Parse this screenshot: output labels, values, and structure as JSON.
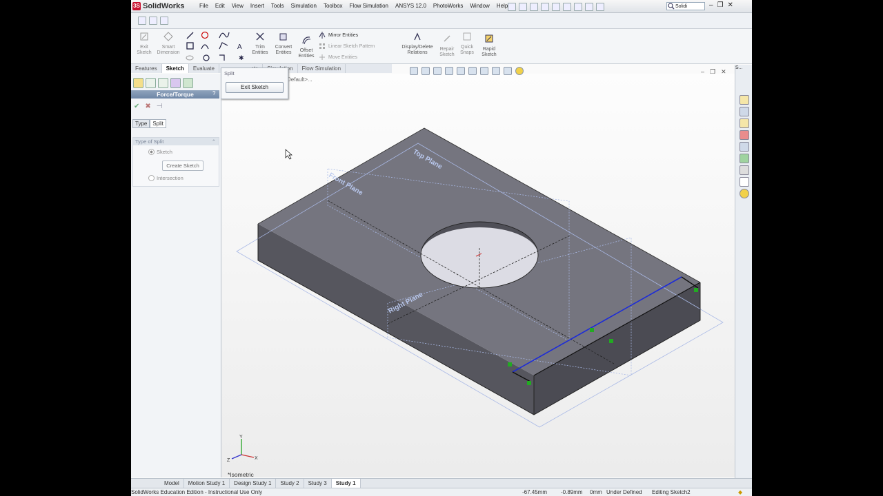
{
  "app": {
    "name": "SolidWorks"
  },
  "menu": [
    "File",
    "Edit",
    "View",
    "Insert",
    "Tools",
    "Simulation",
    "Toolbox",
    "Flow Simulation",
    "ANSYS 12.0",
    "PhotoWorks",
    "Window",
    "Help"
  ],
  "search": {
    "value": "Solidi"
  },
  "commands": {
    "exit_sketch": "Exit\nSketch",
    "smart_dimension": "Smart\nDimension",
    "mirror_entities": "Mirror Entities",
    "linear_sketch_pattern": "Linear Sketch Pattern",
    "move_entities": "Move Entities",
    "trim_entities": "Trim\nEntities",
    "convert_entities": "Convert\nEntities",
    "offset_entities": "Offset\nEntities",
    "display_delete_relations": "Display/Delete\nRelations",
    "repair_sketch": "Repair\nSketch",
    "quick_snaps": "Quick\nSnaps",
    "rapid_sketch": "Rapid\nSketch"
  },
  "tabs": [
    "Features",
    "Sketch",
    "Evaluate",
    "Office Products",
    "Simulation",
    "Flow Simulation"
  ],
  "tabs_visible": {
    "t0": "Features",
    "t1": "Sketch",
    "t2": "Evaluate",
    "t3": "cts",
    "t4": "Simulation",
    "t5": "Flow Simulation"
  },
  "left_panel": {
    "title": "Force/Torque",
    "tab_type": "Type",
    "tab_split": "Split",
    "group_title": "Type of Split",
    "opt_sketch": "Sketch",
    "create_sketch": "Create Sketch",
    "opt_intersection": "Intersection"
  },
  "popup": {
    "title": "Split",
    "exit_sketch": "Exit Sketch"
  },
  "viewport": {
    "breadcrumb": "Default>...",
    "top_plane": "Top Plane",
    "front_plane": "Front Plane",
    "right_plane": "Right Plane",
    "view_name": "*Isometric"
  },
  "bottom_tabs": [
    "Model",
    "Motion Study 1",
    "Design Study 1",
    "Study 2",
    "Study 3",
    "Study 1"
  ],
  "status": {
    "edition": "SolidWorks Education Edition - Instructional Use Only",
    "x": "-67.45mm",
    "y": "-0.89mm",
    "z": "0mm",
    "definition": "Under Defined",
    "editing": "Editing Sketch2"
  },
  "colors": {
    "accent_tab": "#6e86a6",
    "body": "#6f6f78",
    "selected_edge": "#1c2bd8",
    "relation": "#22aa22"
  }
}
